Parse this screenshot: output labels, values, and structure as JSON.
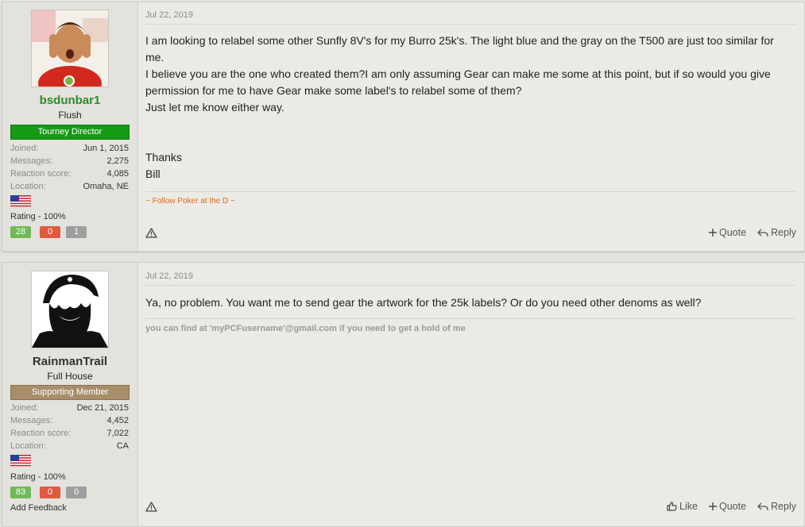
{
  "posts": [
    {
      "user": {
        "name": "bsdunbar1",
        "name_color": "#2e8b2e",
        "title": "Flush",
        "banner": "Tourney Director",
        "banner_color": "#159a15",
        "avatar_icon": "avatar-photo",
        "online": true,
        "stats": [
          {
            "label": "Joined:",
            "value": "Jun 1, 2015"
          },
          {
            "label": "Messages:",
            "value": "2,275"
          },
          {
            "label": "Reaction score:",
            "value": "4,085"
          },
          {
            "label": "Location:",
            "value": "Omaha, NE"
          }
        ],
        "flag_icon": "us-flag-icon",
        "rating": "Rating - 100%",
        "feedback": {
          "positive": "28",
          "negative": "0",
          "neutral": "1"
        }
      },
      "date": "Jul 22, 2019",
      "body": [
        "I am looking to relabel some other Sunfly 8V's for my Burro 25k's. The light blue and the gray on the T500 are just too similar for me.",
        "I believe you are the one who created them?I am only assuming Gear can make me some at this point, but if so would you give permission for me to have Gear make some label's to relabel some of them?",
        "Just let me know either way.",
        "",
        "",
        "Thanks",
        "Bill"
      ],
      "signature": "~ Follow Poker at the D ~",
      "signature_color": "#d86a1f",
      "actions": {
        "quote": "Quote",
        "reply": "Reply"
      }
    },
    {
      "user": {
        "name": "RainmanTrail",
        "name_color": "#333333",
        "title": "Full House",
        "banner": "Supporting Member",
        "banner_color": "#a88f6a",
        "avatar_icon": "avatar-stencil-portrait",
        "online": false,
        "stats": [
          {
            "label": "Joined:",
            "value": "Dec 21, 2015"
          },
          {
            "label": "Messages:",
            "value": "4,452"
          },
          {
            "label": "Reaction score:",
            "value": "7,022"
          },
          {
            "label": "Location:",
            "value": "CA"
          }
        ],
        "flag_icon": "us-flag-icon",
        "rating": "Rating - 100%",
        "feedback": {
          "positive": "83",
          "negative": "0",
          "neutral": "0"
        },
        "add_feedback": "Add Feedback"
      },
      "date": "Jul 22, 2019",
      "body": [
        "Ya, no problem. You want me to send gear the artwork for the 25k labels? Or do you need other denoms as well?"
      ],
      "signature": "you can find at 'myPCFusername'@gmail.com if you need to get a hold of me",
      "signature_color": "#9a9a9a",
      "actions": {
        "like": "Like",
        "quote": "Quote",
        "reply": "Reply"
      }
    }
  ],
  "colors": {
    "positive": "#72b85a",
    "negative": "#e05a3f",
    "neutral": "#9e9e9e"
  }
}
